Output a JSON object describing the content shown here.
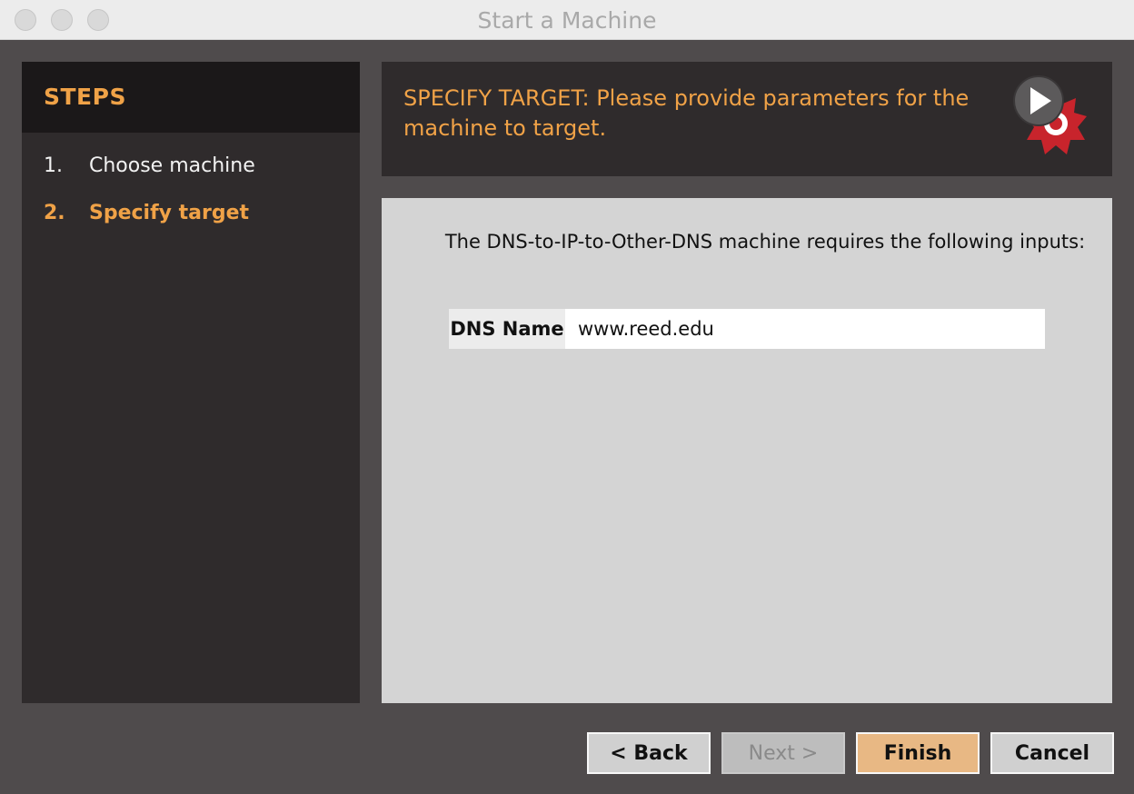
{
  "window": {
    "title": "Start a Machine"
  },
  "steps": {
    "title": "STEPS",
    "items": [
      {
        "num": "1.",
        "label": "Choose machine",
        "active": false
      },
      {
        "num": "2.",
        "label": "Specify target",
        "active": true
      }
    ]
  },
  "banner": {
    "text": "SPECIFY TARGET: Please provide parameters for the machine to target.",
    "logo_icon": "play-gear-logo-icon"
  },
  "content": {
    "description": "The DNS-to-IP-to-Other-DNS machine requires the following inputs:",
    "field": {
      "label": "DNS Name",
      "value": "www.reed.edu"
    }
  },
  "buttons": {
    "back": "< Back",
    "next": "Next >",
    "finish": "Finish",
    "cancel": "Cancel"
  },
  "colors": {
    "accent": "#f0a247",
    "panel_dark": "#2f2b2c",
    "window_bg": "#4f4b4c",
    "finish_button": "#e8b884"
  }
}
